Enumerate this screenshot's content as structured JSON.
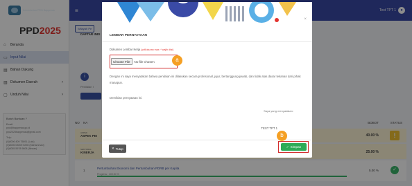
{
  "sidebar": {
    "org_text": "Kementerian PPN/ Bappenas",
    "brand_prefix": "PPD",
    "brand_year": "2025",
    "items": [
      {
        "icon": "home-icon",
        "glyph": "⌂",
        "label": "Beranda"
      },
      {
        "icon": "input-icon",
        "glyph": "▭",
        "label": "Input Nilai"
      },
      {
        "icon": "file-icon",
        "glyph": "▤",
        "label": "Bahan Dukung"
      },
      {
        "icon": "document-icon",
        "glyph": "▥",
        "label": "Dokumen Daerah"
      },
      {
        "icon": "monitor-icon",
        "glyph": "▢",
        "label": "Unduh Nilai"
      }
    ],
    "help": {
      "title": "Butuh Bantuan ?",
      "email_label": "Email:",
      "email_1": "ppd@bappenas.go.id",
      "email_2": "ppd2025bappenas@gmail.com",
      "phone_label": "Telp:",
      "phone_1": "(0)8006 409 75891 (Lulu)",
      "phone_2": "(0)8006 03009 5298 (Muhammad)",
      "phone_3": "(0)8055 5978 9808 (Ikhsan)"
    }
  },
  "topbar": {
    "user_name": "Test TPT 1"
  },
  "main": {
    "back_button": "Wilayah Pe",
    "section_title": "DAFTAR INDI",
    "info_label": "Penilaian I",
    "table": {
      "col_no": "NO",
      "col_name": "NA",
      "col_bobot": "BOBOT",
      "col_status": "STATUS",
      "aspek_label_top": "ASPEK",
      "aspek_label": "ASPEK PEI",
      "aspek_bobot": "40.00 %",
      "sub_label_top": "SEKTORAL",
      "sub_label": "KINERJA",
      "sub_bobot": "25.00 %",
      "item_no": "1",
      "item_name": "Pertumbuhan Ekonomi dan Pertumbuhan PDRB per Kapita",
      "item_progress_label": "Progress : 100.00 %",
      "item_progress": 100,
      "item_bobot": "5.00 %"
    }
  },
  "modal": {
    "title": "LEMBAR PERNYATAAN",
    "close_glyph": "×",
    "doc_label": "Dokumen Lembar Kerja",
    "doc_required": "(pdf/ukuran max: * wajib diisi)",
    "file_button": "Choose File",
    "file_status": "No file chosen",
    "statement": "Dengan ini saya menyatakan bahwa penilaian ini dilakukan secara profesional, jujur, bertanggung-jawab, dan tidak atas dasar tekanan dari pihak manapun.",
    "closing": "Demikian pernyataan ini.",
    "maker_label": "Saya yang menyatakan:",
    "signer_name": "TEST TPT 1",
    "close_button": "Tutup",
    "save_button": "Simpan"
  },
  "markers": {
    "a": "a",
    "b": "b"
  },
  "colors": {
    "topbar": "#3a4aa6",
    "save": "#2eab57",
    "marker": "#f5a024",
    "highlight": "#d32f2f"
  }
}
